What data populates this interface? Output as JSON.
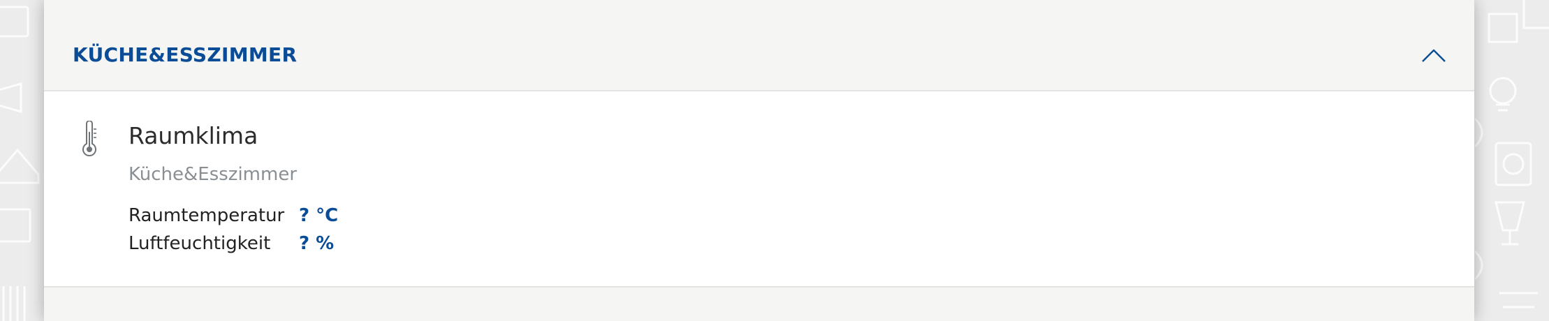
{
  "section": {
    "title": "KÜCHE&ESSZIMMER",
    "expanded": true,
    "toggle_icon": "chevron-up-icon"
  },
  "card": {
    "icon": "thermometer-icon",
    "title": "Raumklima",
    "subtitle": "Küche&Esszimmer",
    "measurements": [
      {
        "label": "Raumtemperatur",
        "value": "? °C"
      },
      {
        "label": "Luftfeuchtigkeit",
        "value": "? %"
      }
    ]
  },
  "colors": {
    "accent": "#0b4c96",
    "panel_bg": "#f5f5f4",
    "card_bg": "#ffffff",
    "page_bg": "#ececec",
    "subtitle": "#8a8f93"
  }
}
